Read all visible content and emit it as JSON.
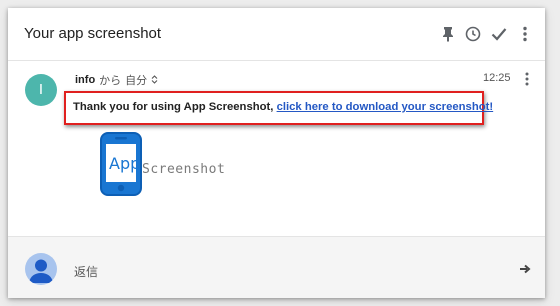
{
  "header": {
    "subject": "Your app screenshot",
    "icons": [
      "pin-icon",
      "clock-icon",
      "check-icon",
      "more-vert-icon"
    ]
  },
  "message": {
    "avatar_letter": "I",
    "sender": "info",
    "from_particle": "から",
    "recipient": "自分",
    "time": "12:25",
    "body_text": "Thank you for using App Screenshot, ",
    "body_link": "click here to download your screenshot!",
    "logo": {
      "prefix": "App",
      "name": "Screenshot"
    }
  },
  "reply": {
    "label": "返信"
  },
  "colors": {
    "avatar": "#4db6ac",
    "highlight_border": "#e0201f",
    "link": "#2458c4",
    "logo_blue": "#1976d2"
  }
}
